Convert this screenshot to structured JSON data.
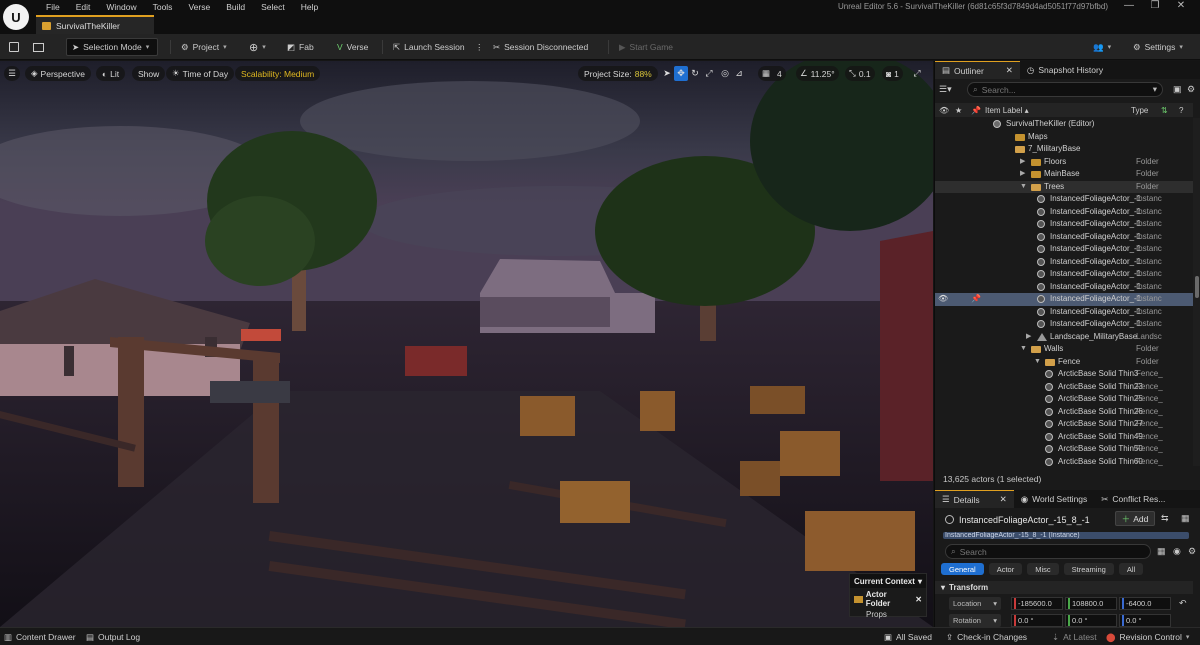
{
  "app": {
    "menu": [
      "File",
      "Edit",
      "Window",
      "Tools",
      "Verse",
      "Build",
      "Select",
      "Help"
    ],
    "project_tab": "SurvivalTheKiller",
    "window_title": "Unreal Editor 5.6 - SurvivalTheKiller (6d81c65f3d7849d4ad5051f77d97bfbd)"
  },
  "toolbar": {
    "selection_mode": "Selection Mode",
    "project": "Project",
    "fab": "Fab",
    "verse": "Verse",
    "launch_session": "Launch Session",
    "session_status": "Session Disconnected",
    "start_game": "Start Game",
    "settings": "Settings"
  },
  "viewport": {
    "perspective": "Perspective",
    "lit": "Lit",
    "show": "Show",
    "time_of_day": "Time of Day",
    "scalability": "Scalability: Medium",
    "project_size_label": "Project Size:",
    "project_size_value": "88%",
    "grid_size": "4",
    "rotation_snap": "11.25°",
    "scale_snap": "0.1",
    "camera_speed": "1",
    "current_context": {
      "title": "Current Context",
      "folder_label": "Actor Folder",
      "folder_name": "Props"
    }
  },
  "outliner": {
    "tab": "Outliner",
    "snapshot_tab": "Snapshot History",
    "search_placeholder": "Search...",
    "col_label": "Item Label ▴",
    "col_type": "Type",
    "rows": [
      {
        "label": "SurvivalTheKiller (Editor)",
        "type": "",
        "kind": "world",
        "indent": 58
      },
      {
        "label": "Maps",
        "type": "",
        "kind": "folder",
        "indent": 80
      },
      {
        "label": "7_MilitaryBase",
        "type": "",
        "kind": "folder-open",
        "indent": 80
      },
      {
        "label": "Floors",
        "type": "Folder",
        "kind": "folder",
        "indent": 96,
        "arrow": "▶"
      },
      {
        "label": "MainBase",
        "type": "Folder",
        "kind": "folder",
        "indent": 96,
        "arrow": "▶"
      },
      {
        "label": "Trees",
        "type": "Folder",
        "kind": "folder-open",
        "indent": 96,
        "arrow": "▼",
        "hl": true
      },
      {
        "label": "InstancedFoliageActor_-1",
        "type": "Instanc",
        "kind": "mesh",
        "indent": 102
      },
      {
        "label": "InstancedFoliageActor_-1",
        "type": "Instanc",
        "kind": "mesh",
        "indent": 102
      },
      {
        "label": "InstancedFoliageActor_-1",
        "type": "Instanc",
        "kind": "mesh",
        "indent": 102
      },
      {
        "label": "InstancedFoliageActor_-1",
        "type": "Instanc",
        "kind": "mesh",
        "indent": 102
      },
      {
        "label": "InstancedFoliageActor_-1",
        "type": "Instanc",
        "kind": "mesh",
        "indent": 102
      },
      {
        "label": "InstancedFoliageActor_-1",
        "type": "Instanc",
        "kind": "mesh",
        "indent": 102
      },
      {
        "label": "InstancedFoliageActor_-1",
        "type": "Instanc",
        "kind": "mesh",
        "indent": 102
      },
      {
        "label": "InstancedFoliageActor_-1",
        "type": "Instanc",
        "kind": "mesh",
        "indent": 102
      },
      {
        "label": "InstancedFoliageActor_-1",
        "type": "Instanc",
        "kind": "mesh",
        "indent": 102,
        "sel": true
      },
      {
        "label": "InstancedFoliageActor_-1",
        "type": "Instanc",
        "kind": "mesh",
        "indent": 102
      },
      {
        "label": "InstancedFoliageActor_-1",
        "type": "Instanc",
        "kind": "mesh",
        "indent": 102
      },
      {
        "label": "Landscape_MilitaryBase",
        "type": "Landsc",
        "kind": "land",
        "indent": 102,
        "arrow": "▶"
      },
      {
        "label": "Walls",
        "type": "Folder",
        "kind": "folder-open",
        "indent": 96,
        "arrow": "▼"
      },
      {
        "label": "Fence",
        "type": "Folder",
        "kind": "folder-open",
        "indent": 110,
        "arrow": "▼"
      },
      {
        "label": "ArcticBase Solid Thin3",
        "type": "Fence_",
        "kind": "mesh",
        "indent": 110
      },
      {
        "label": "ArcticBase Solid Thin23",
        "type": "Fence_",
        "kind": "mesh",
        "indent": 110
      },
      {
        "label": "ArcticBase Solid Thin25",
        "type": "Fence_",
        "kind": "mesh",
        "indent": 110
      },
      {
        "label": "ArcticBase Solid Thin26",
        "type": "Fence_",
        "kind": "mesh",
        "indent": 110
      },
      {
        "label": "ArcticBase Solid Thin27",
        "type": "Fence_",
        "kind": "mesh",
        "indent": 110
      },
      {
        "label": "ArcticBase Solid Thin49",
        "type": "Fence_",
        "kind": "mesh",
        "indent": 110
      },
      {
        "label": "ArcticBase Solid Thin50",
        "type": "Fence_",
        "kind": "mesh",
        "indent": 110
      },
      {
        "label": "ArcticBase Solid Thin60",
        "type": "Fence_",
        "kind": "mesh",
        "indent": 110
      }
    ],
    "actor_count": "13,625 actors (1 selected)"
  },
  "details": {
    "tab": "Details",
    "world_settings_tab": "World Settings",
    "conflict_tab": "Conflict Res...",
    "actor_name": "InstancedFoliageActor_-15_8_-1",
    "add": "Add",
    "component_row": "InstancedFoliageActor_-15_8_-1 (Instance)",
    "search_placeholder": "Search",
    "filters": [
      "General",
      "Actor",
      "Misc",
      "Streaming",
      "All"
    ],
    "section": "Transform",
    "location_label": "Location",
    "location": [
      "-185600.0",
      "108800.0",
      "-6400.0"
    ],
    "rotation_label": "Rotation",
    "rotation": [
      "0.0 °",
      "0.0 °",
      "0.0 °"
    ]
  },
  "statusbar": {
    "content_drawer": "Content Drawer",
    "output_log": "Output Log",
    "all_saved": "All Saved",
    "check_in": "Check-in Changes",
    "at_latest": "At Latest",
    "revision_control": "Revision Control"
  },
  "colors": {
    "accent": "#e0a020",
    "selection": "#4c5a72",
    "filter_active": "#1f6fd1",
    "scalability": "#e0b820"
  }
}
